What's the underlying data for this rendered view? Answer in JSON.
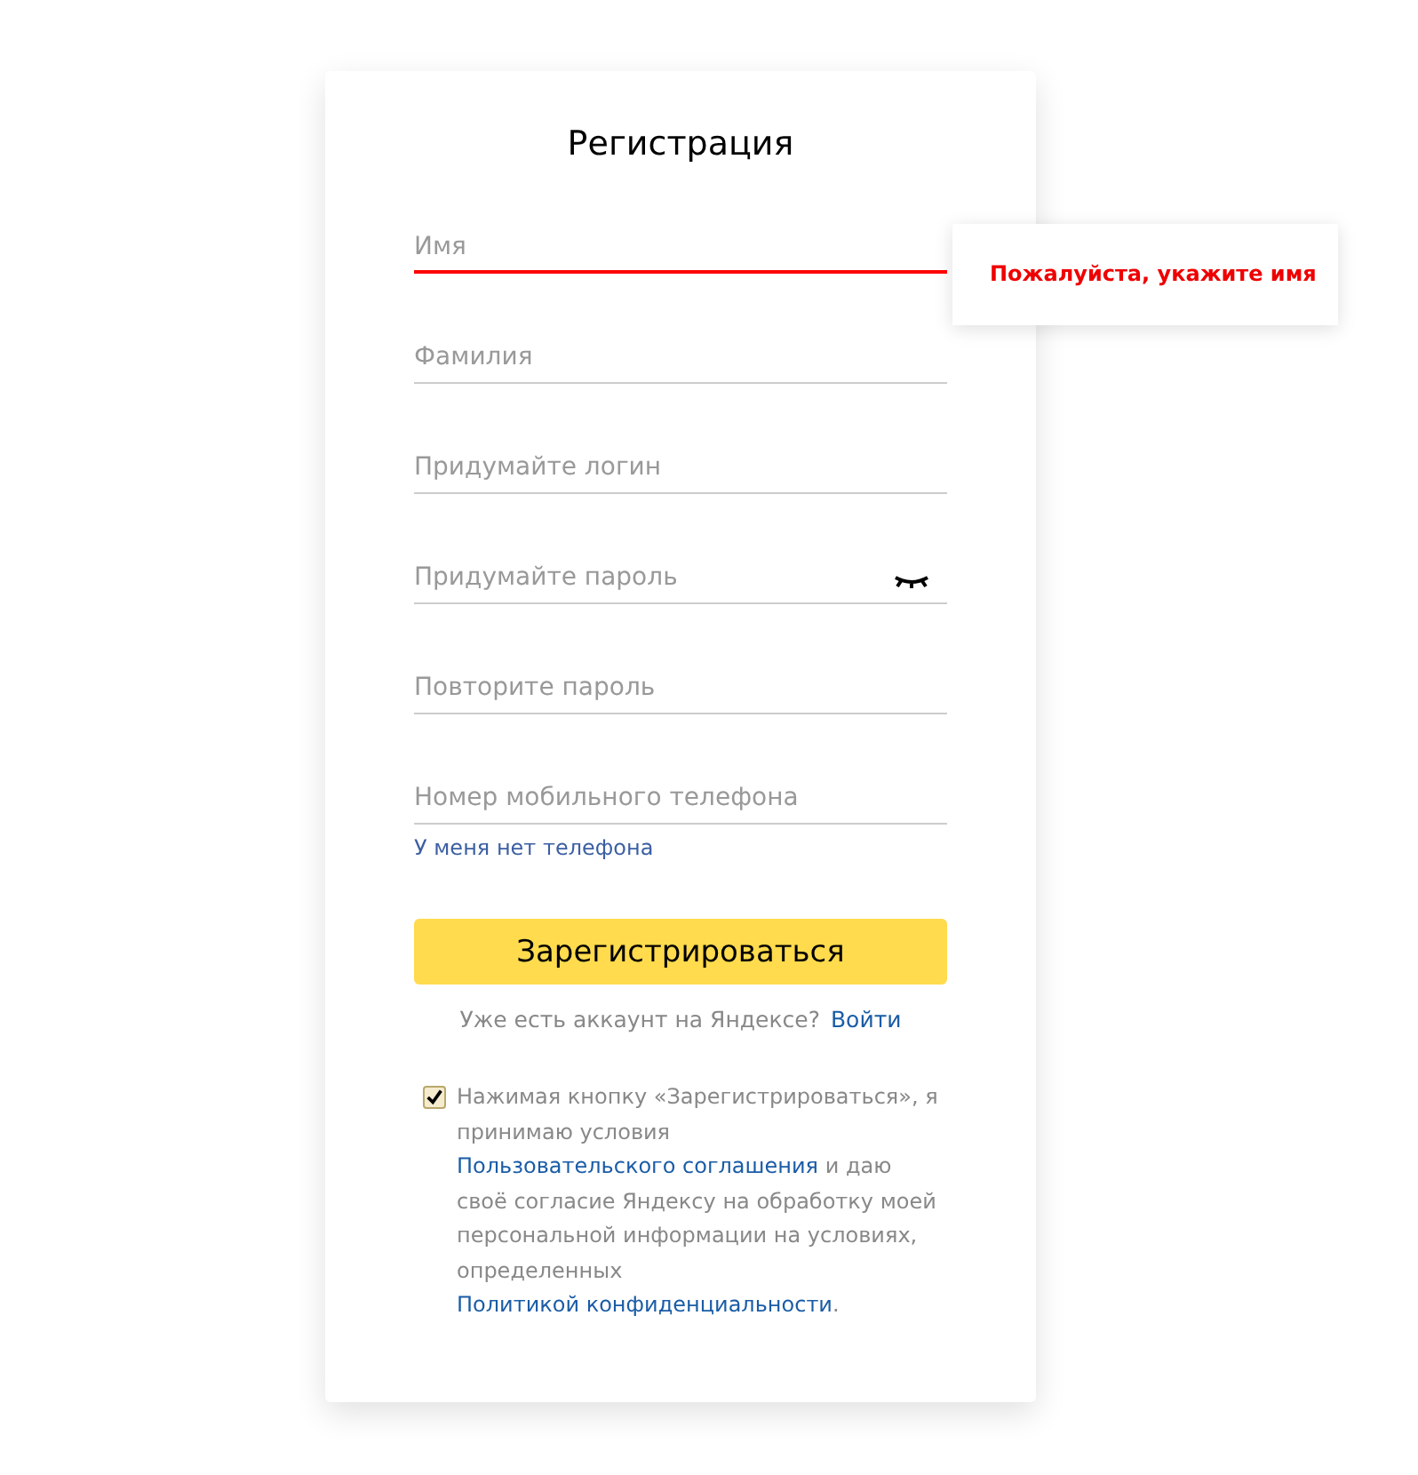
{
  "title": "Регистрация",
  "fields": [
    {
      "placeholder": "Имя",
      "error": true,
      "password_toggle": false
    },
    {
      "placeholder": "Фамилия",
      "error": false,
      "password_toggle": false
    },
    {
      "placeholder": "Придумайте логин",
      "error": false,
      "password_toggle": false
    },
    {
      "placeholder": "Придумайте пароль",
      "error": false,
      "password_toggle": true
    },
    {
      "placeholder": "Повторите пароль",
      "error": false,
      "password_toggle": false
    },
    {
      "placeholder": "Номер мобильного телефона",
      "error": false,
      "password_toggle": false
    }
  ],
  "no_phone_link": "У меня нет телефона",
  "error_tooltip": "Пожалуйста, укажите имя",
  "submit_button": "Зарегистрироваться",
  "login_prompt": {
    "text": "Уже есть аккаунт на Яндексе?",
    "link": "Войти"
  },
  "consent": {
    "checked": true,
    "parts": [
      {
        "kind": "text",
        "text": "Нажимая кнопку «Зарегистрироваться», я принимаю условия "
      },
      {
        "kind": "link",
        "text": "Пользовательского соглашения"
      },
      {
        "kind": "text",
        "text": " и даю своё согласие Яндексу на обработку моей персональной информации на условиях, определенных "
      },
      {
        "kind": "link",
        "text": "Политикой конфиденциальности"
      },
      {
        "kind": "text",
        "text": "."
      }
    ]
  }
}
